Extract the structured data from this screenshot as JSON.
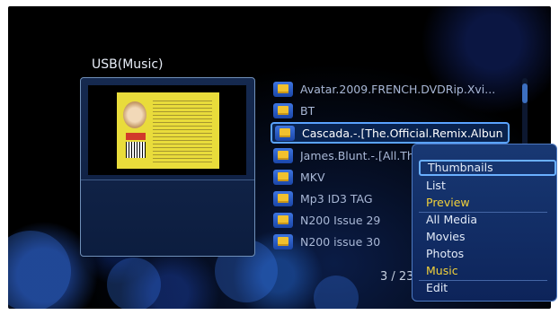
{
  "screen": {
    "title": "USB(Music)",
    "page_counter": "3 / 23"
  },
  "file_list": {
    "items": [
      {
        "label": "Avatar.2009.FRENCH.DVDRip.Xvi...",
        "icon": "folder-icon",
        "selected": false
      },
      {
        "label": "BT",
        "icon": "folder-icon",
        "selected": false
      },
      {
        "label": "Cascada.-.[The.Official.Remix.Albun",
        "icon": "folder-icon",
        "selected": true
      },
      {
        "label": "James.Blunt.-.[All.Th",
        "icon": "folder-icon",
        "selected": false
      },
      {
        "label": "MKV",
        "icon": "folder-icon",
        "selected": false
      },
      {
        "label": "Mp3 ID3 TAG",
        "icon": "folder-icon",
        "selected": false
      },
      {
        "label": "N200 Issue 29",
        "icon": "folder-icon",
        "selected": false
      },
      {
        "label": "N200 issue 30",
        "icon": "folder-icon",
        "selected": false
      }
    ]
  },
  "context_menu": {
    "view_group": [
      {
        "label": "Thumbnails",
        "state": "focused"
      },
      {
        "label": "List",
        "state": "normal"
      },
      {
        "label": "Preview",
        "state": "active"
      }
    ],
    "filter_group": [
      {
        "label": "All Media",
        "state": "normal"
      },
      {
        "label": "Movies",
        "state": "normal"
      },
      {
        "label": "Photos",
        "state": "normal"
      },
      {
        "label": "Music",
        "state": "active"
      }
    ],
    "action_group": [
      {
        "label": "Edit",
        "state": "normal"
      }
    ]
  },
  "colors": {
    "selection_border": "#5aa3ff",
    "active_menu_text": "#f3d23a",
    "menu_background": "#183873"
  }
}
